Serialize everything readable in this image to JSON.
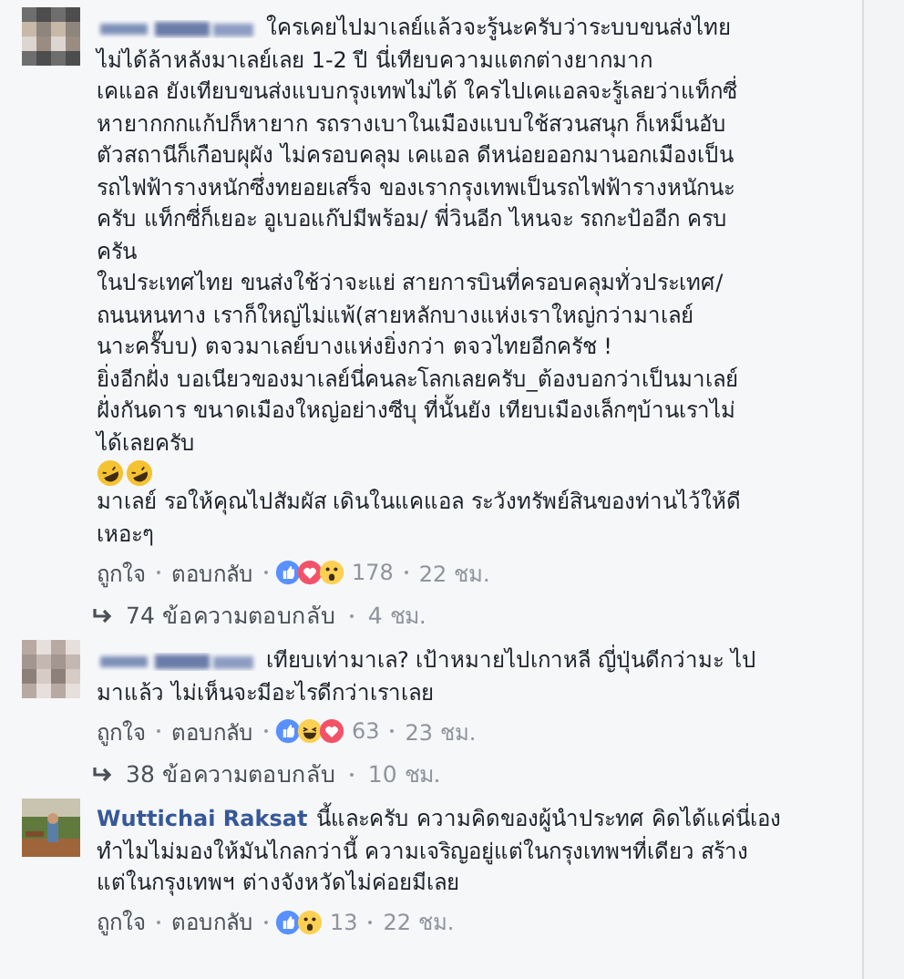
{
  "comments": [
    {
      "lines": [
        [
          "ใครเคยไปมาเลย์แล้วจะรู้นะครับว่าระบบขนส่งไทย"
        ],
        [
          "ไม่ได้ล้าหลังมาเลย์เลย 1-2 ปี นี่เทียบความแตกต่างยากมาก"
        ],
        [
          "เคแอล ยังเทียบขนส่งแบบกรุงเทพไม่ได้ ใครไปเคแอลจะรู้เลยว่าแท็กซี่"
        ],
        [
          "หายากกกแก้ปก็หายาก รถรางเบาในเมืองแบบใช้สวนสนุก ก็เหม็นอับ"
        ],
        [
          "ตัวสถานีก็เกือบผุผัง ไม่ครอบคลุม เคแอล ดีหน่อยออกมานอกเมืองเป็น"
        ],
        [
          "รถไฟฟ้ารางหนักซึ่งทยอยเสร็จ ของเรากรุงเทพเป็นรถไฟฟ้ารางหนักนะ"
        ],
        [
          "ครับ แท็กซี่ก็เยอะ อูเบอแก๊ปมีพร้อม/ พี่วินอีก ไหนจะ รถกะป้ออีก ครบ"
        ],
        [
          "ครัน"
        ],
        [
          "ในประเทศไทย ขนส่งใช้ว่าจะแย่ สายการบินที่ครอบคลุมทั่วประเทศ/"
        ],
        [
          "ถนนหนทาง เราก็ใหญ่ไม่แพ้(สายหลักบางแห่งเราใหญ่กว่ามาเลย์"
        ],
        [
          "นาะครั๊บบ) ตจวมาเลย์บางแห่งยิ่งกว่า ตจวไทยอีกครัช !"
        ],
        [
          "ยิ่งอีกฝั่ง บอเนียวของมาเลย์นี่คนละโลกเลยครับ_ต้องบอกว่าเป็นมาเลย์"
        ],
        [
          "ฝั่งกันดาร ขนาดเมืองใหญ่อย่างซีบุ ที่นั้นยัง เทียบเมืองเล็กๆบ้านเราไม่"
        ],
        [
          "ได้เลยครับ"
        ]
      ],
      "emojis": [
        {
          "kind": "rofl"
        },
        {
          "kind": "rofl"
        }
      ],
      "lines_after": [
        [
          "มาเลย์ รอให้คุณไปสัมผัส เดินในแคแอล ระวังทรัพย์สินของท่านไว้ให้ดี"
        ],
        [
          "เหอะๆ"
        ]
      ],
      "like": "ถูกใจ",
      "reply": "ตอบกลับ",
      "reactions": [
        {
          "kind": "like"
        },
        {
          "kind": "love"
        },
        {
          "kind": "wow"
        }
      ],
      "count": "178",
      "time": "22 ชม.",
      "replies": {
        "text": "74 ข้อความตอบกลับ",
        "time": "4 ชม."
      }
    },
    {
      "lines": [
        [
          "เทียบเท่ามาเล? เป้าหมายไปเกาหลี ญี่ปุ่นดีกว่ามะ ไป"
        ],
        [
          "มาแล้ว ไม่เห็นจะมีอะไรดีกว่าเราเลย"
        ]
      ],
      "like": "ถูกใจ",
      "reply": "ตอบกลับ",
      "reactions": [
        {
          "kind": "like"
        },
        {
          "kind": "haha"
        },
        {
          "kind": "love"
        }
      ],
      "count": "63",
      "time": "23 ชม.",
      "replies": {
        "text": "38 ข้อความตอบกลับ",
        "time": "10 ชม."
      }
    },
    {
      "author": "Wuttichai Raksat",
      "lines": [
        [
          "นี้และครับ ความคิดของผู้นำประทศ คิดได้แค่นี่เอง"
        ],
        [
          "ทำไมไม่มองให้มันไกลกว่านี้ ความเจริญอยู่แต่ในกรุงเทพฯที่เดียว สร้าง"
        ],
        [
          "แต่ในกรุงเทพฯ ต่างจังหวัดไม่ค่อยมีเลย"
        ]
      ],
      "like": "ถูกใจ",
      "reply": "ตอบกลับ",
      "reactions": [
        {
          "kind": "like"
        },
        {
          "kind": "wow"
        }
      ],
      "count": "13",
      "time": "22 ชม."
    }
  ]
}
